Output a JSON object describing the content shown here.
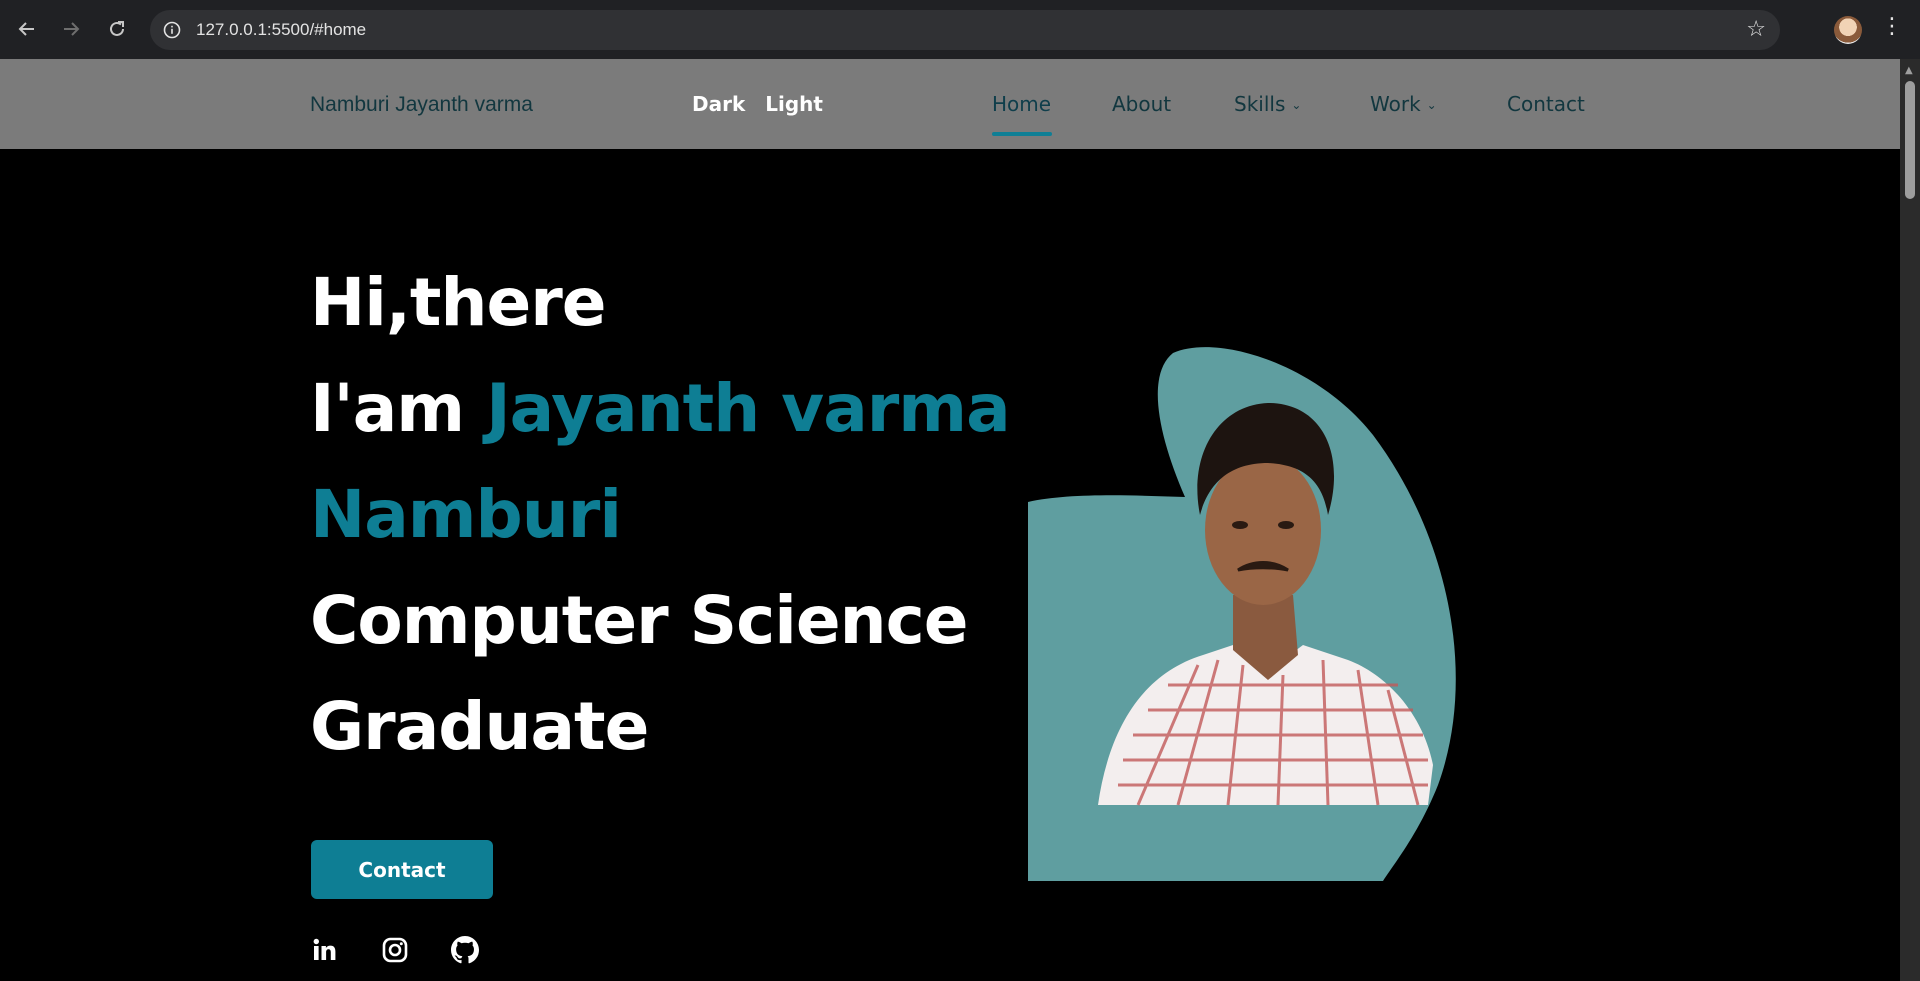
{
  "browser": {
    "url": "127.0.0.1:5500/#home",
    "back_icon": "arrow-left-icon",
    "forward_icon": "arrow-right-icon",
    "reload_icon": "reload-icon",
    "site_info_icon": "info-icon",
    "bookmark_icon": "star-icon",
    "menu_icon": "kebab-icon"
  },
  "navbar": {
    "brand": "Namburi Jayanth varma",
    "theme": {
      "dark": "Dark",
      "light": "Light"
    },
    "items": [
      {
        "label": "Home",
        "active": true
      },
      {
        "label": "About"
      },
      {
        "label": "Skills",
        "has_dropdown": true
      },
      {
        "label": "Work",
        "has_dropdown": true
      },
      {
        "label": "Contact"
      }
    ]
  },
  "hero": {
    "line1": "Hi,there",
    "line2_prefix": "I'am ",
    "name_part1": "Jayanth varma",
    "name_part2": "Namburi",
    "line4": "Computer Science",
    "line5": "Graduate",
    "cta": "Contact",
    "socials": [
      "linkedin-icon",
      "instagram-icon",
      "github-icon"
    ],
    "accent": "#0e7e94",
    "blob_color": "#5f9ea0"
  }
}
